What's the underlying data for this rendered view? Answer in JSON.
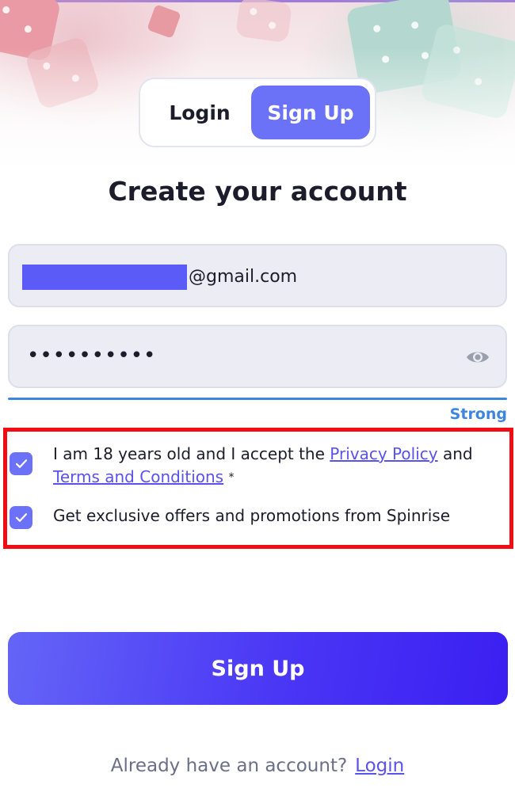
{
  "auth_toggle": {
    "login_label": "Login",
    "signup_label": "Sign Up",
    "active": "signup"
  },
  "heading": "Create your account",
  "email": {
    "value_visible_suffix": "@gmail.com",
    "redacted": true
  },
  "password": {
    "masked_value": "••••••••••",
    "toggle_icon": "eye-icon"
  },
  "strength": {
    "label": "Strong",
    "color": "#3d86e0"
  },
  "consents": {
    "age_terms": {
      "checked": true,
      "text_before": "I am 18 years old and I accept the ",
      "privacy_link": "Privacy Policy",
      "text_and": " and",
      "terms_link": "Terms and Conditions",
      "required_mark": "*"
    },
    "offers": {
      "checked": true,
      "text": "Get exclusive offers and promotions from Spinrise"
    }
  },
  "submit_label": "Sign Up",
  "footer": {
    "prompt": "Already have an account?",
    "login_link": "Login"
  },
  "colors": {
    "accent": "#6b72f7",
    "highlight_border": "#f20d14",
    "link": "#5a52f0"
  }
}
